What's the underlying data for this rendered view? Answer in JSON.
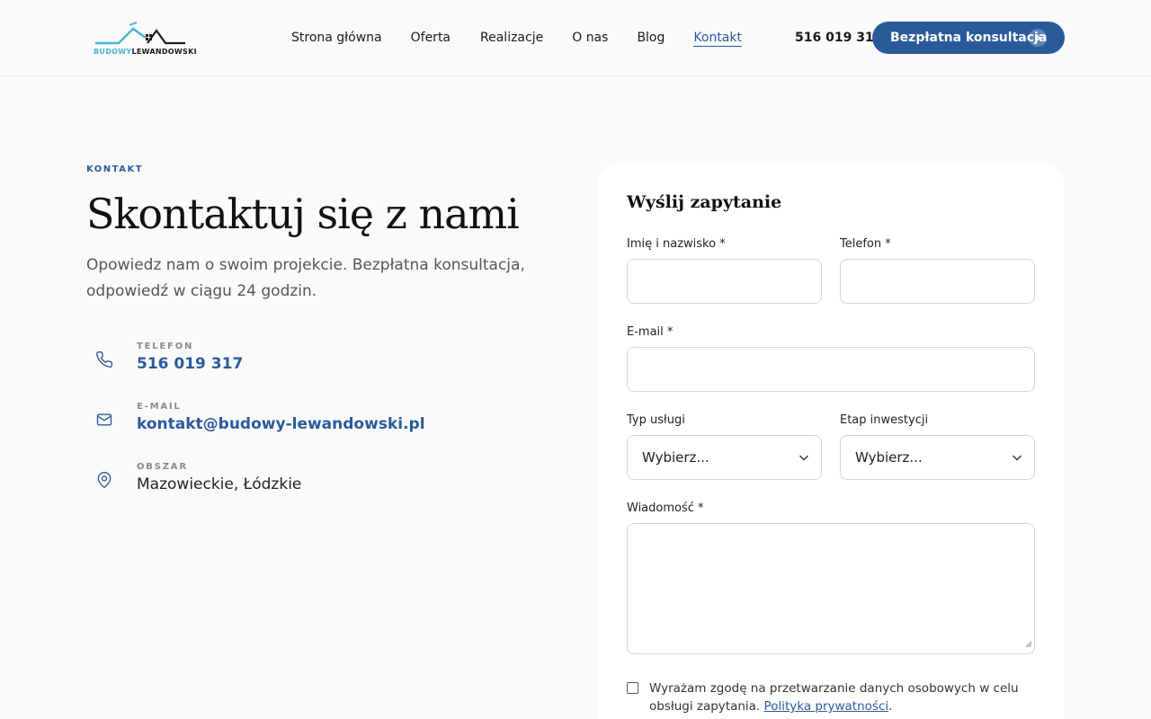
{
  "logo": {
    "part1": "BUDOWY",
    "part2": "LEWANDOWSKI"
  },
  "nav": {
    "items": [
      "Strona główna",
      "Oferta",
      "Realizacje",
      "O nas",
      "Blog",
      "Kontakt"
    ],
    "active": "Kontakt"
  },
  "header": {
    "phone": "516 019 317",
    "cta_label": "Bezpłatna konsultacja"
  },
  "hero": {
    "eyebrow": "KONTAKT",
    "title": "Skontaktuj się z nami",
    "lead": "Opowiedz nam o swoim projekcie. Bezpłatna konsultacja, odpowiedź w ciągu 24 godzin."
  },
  "contacts": {
    "phone": {
      "label": "TELEFON",
      "value": "516 019 317",
      "icon": "phone-icon"
    },
    "email": {
      "label": "E-MAIL",
      "value": "kontakt@budowy-lewandowski.pl",
      "icon": "mail-icon"
    },
    "area": {
      "label": "OBSZAR",
      "value": "Mazowieckie, Łódzkie",
      "icon": "map-pin-icon"
    }
  },
  "form": {
    "title": "Wyślij zapytanie",
    "name_label": "Imię i nazwisko *",
    "name_value": "",
    "phone_label": "Telefon *",
    "phone_value": "",
    "email_label": "E-mail *",
    "email_value": "",
    "service_label": "Typ usługi",
    "service_value": "Wybierz...",
    "stage_label": "Etap inwestycji",
    "stage_value": "Wybierz...",
    "message_label": "Wiadomość *",
    "message_value": "",
    "consent_text": "Wyrażam zgodę na przetwarzanie danych osobowych w celu obsługi zapytania.",
    "consent_link": "Polityka prywatności",
    "consent_end": "."
  },
  "colors": {
    "accent": "#2b5a9a",
    "logo_blue": "#4ab3d4",
    "background": "#fafafa"
  }
}
